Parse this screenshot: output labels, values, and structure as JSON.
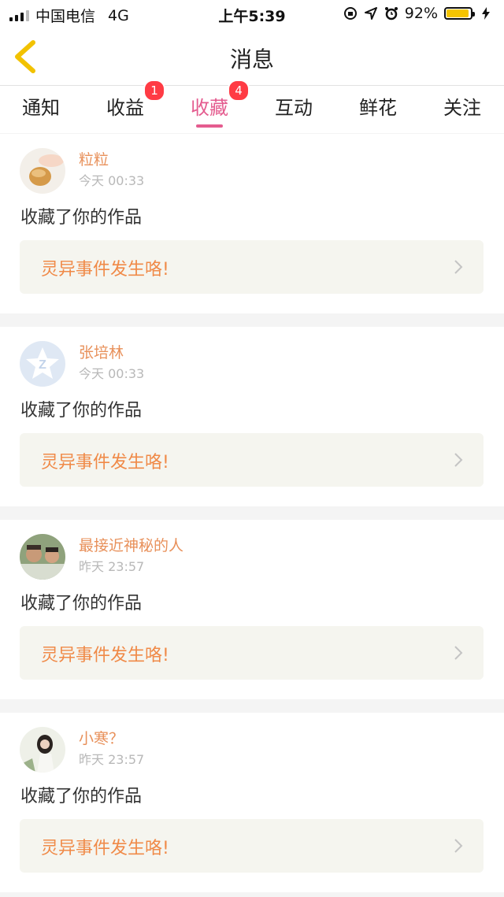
{
  "status_bar": {
    "carrier": "中国电信",
    "network": "4G",
    "time": "上午5:39",
    "battery": "92%",
    "battery_level": 0.92,
    "battery_color": "#f5c400"
  },
  "nav": {
    "title": "消息",
    "back_icon": "chevron-left-icon",
    "back_color": "#f2c200"
  },
  "tabs": [
    {
      "label": "通知",
      "badge": ""
    },
    {
      "label": "收益",
      "badge": "1"
    },
    {
      "label": "收藏",
      "badge": "4",
      "active": true
    },
    {
      "label": "互动",
      "badge": ""
    },
    {
      "label": "鲜花",
      "badge": ""
    },
    {
      "label": "关注",
      "badge": ""
    }
  ],
  "colors": {
    "accent": "#e45c8f",
    "badge": "#ff3b44",
    "username": "#e8905a",
    "work_title": "#f08a48"
  },
  "messages": [
    {
      "user": "粒粒",
      "time": "今天 00:33",
      "action": "收藏了你的作品",
      "work": "灵异事件发生咯!"
    },
    {
      "user": "张培林",
      "time": "今天 00:33",
      "action": "收藏了你的作品",
      "work": "灵异事件发生咯!"
    },
    {
      "user": "最接近神秘的人",
      "time": "昨天 23:57",
      "action": "收藏了你的作品",
      "work": "灵异事件发生咯!"
    },
    {
      "user": "小寒？",
      "time": "昨天 23:57",
      "action": "收藏了你的作品",
      "work": "灵异事件发生咯!"
    }
  ]
}
